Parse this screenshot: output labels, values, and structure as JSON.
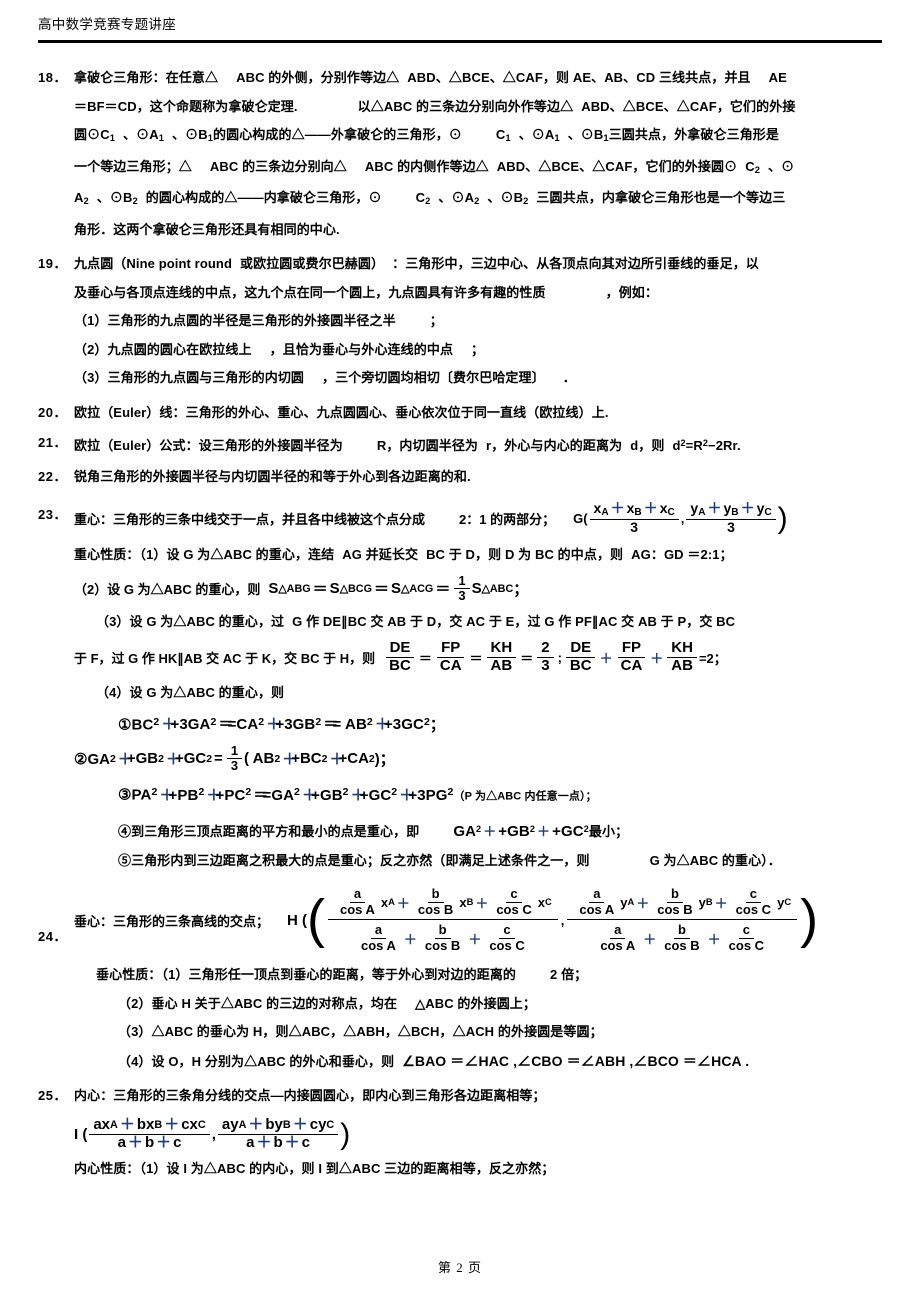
{
  "header": {
    "title": "高中数学竞赛专题讲座"
  },
  "footer": {
    "page_label": "第 2 页"
  },
  "items": {
    "n18": {
      "num": "18．",
      "l1a": "拿破仑三角形：在任意△",
      "l1b": "ABC 的外侧，分别作等边△",
      "l1c": "ABD、△BCE、△CAF，则 AE、AB、CD 三线共点，并且",
      "l1d": "AE",
      "l2a": "＝BF＝CD，这个命题称为拿破仑定理.",
      "l2b": "以△ABC 的三条边分别向外作等边△",
      "l2c": "ABD、△BCE、△CAF，它们的外接",
      "l3a": "圆⊙C",
      "l3a_sub": "1",
      "l3b": "、⊙A",
      "l3b_sub": "1",
      "l3c": "、⊙B",
      "l3c_sub": "1",
      "l3d": "的圆心构成的△——外拿破仑的三角形，⊙",
      "l3e": "C",
      "l3e_sub": "1",
      "l3f": "、⊙A",
      "l3f_sub": "1",
      "l3g": "、⊙B",
      "l3g_sub": "1",
      "l3h": "三圆共点，外拿破仑三角形是",
      "l4a": "一个等边三角形；△",
      "l4b": "ABC 的三条边分别向△",
      "l4c": "ABC 的内侧作等边△",
      "l4d": "ABD、△BCE、△CAF，它们的外接圆⊙",
      "l4e": "C",
      "l4e_sub": "2",
      "l4f": "、⊙",
      "l5a": "A",
      "l5a_sub": "2",
      "l5b": "、⊙B",
      "l5b_sub": "2",
      "l5c": "的圆心构成的△——内拿破仑三角形，⊙",
      "l5d": "C",
      "l5d_sub": "2",
      "l5e": "、⊙A",
      "l5e_sub": "2",
      "l5f": "、⊙B",
      "l5f_sub": "2",
      "l5g": "三圆共点，内拿破仑三角形也是一个等边三",
      "l6": "角形．这两个拿破仑三角形还具有相同的中心."
    },
    "n19": {
      "num": "19．",
      "l1a": "九点圆（",
      "l1b": "Nine point round",
      "l1c": "或欧拉圆或费尔巴赫圆）",
      "l1d": "：三角形中，三边中心、从各顶点向其对边所引垂线的垂足，以",
      "l2a": "及垂心与各顶点连线的中点，这九个点在同一个圆上，九点圆具有许多有趣的性质",
      "l2b": "，例如：",
      "p1a": "（1）三角形的九点圆的半径是三角形的外接圆半径之半",
      "p1b": "；",
      "p2a": "（2）九点圆的圆心在欧拉线上",
      "p2b": "，且恰为垂心与外心连线的中点",
      "p2c": "；",
      "p3a": "（3）三角形的九点圆与三角形的内切圆",
      "p3b": "，三个旁切圆均相切〔费尔巴哈定理〕",
      "p3c": "．"
    },
    "n20": {
      "num": "20．",
      "text": "欧拉（Euler）线：三角形的外心、重心、九点圆圆心、垂心依次位于同一直线（欧拉线）上."
    },
    "n21": {
      "num": "21．",
      "t1": "欧拉（Euler）公式：设三角形的外接圆半径为",
      "t2": "R，内切圆半径为",
      "t3": "r，外心与内心的距离为",
      "t4": "d，则",
      "t5_d": "d",
      "t5_sup": "2",
      "t5_eq": "=R",
      "t5_sup2": "2",
      "t5_rest": "−2Rr."
    },
    "n22": {
      "num": "22．",
      "text": "锐角三角形的外接圆半径与内切圆半径的和等于外心到各边距离的和."
    },
    "n23": {
      "num": "23．",
      "l1a": "重心：三角形的三条中线交于一点，并且各中线被这个点分成",
      "l1b": "2：1 的两部分；",
      "g_label": "G(",
      "g_num1": "x",
      "g_num1_subs": [
        "A",
        "B",
        "C"
      ],
      "g_den": "3",
      "g_num2": "y",
      "g_num2_subs": [
        "A",
        "B",
        "C"
      ],
      "g_close": ")",
      "p1a": "重心性质：（1）设 G 为△ABC 的重心，连结",
      "p1b": "AG 并延长交",
      "p1c": "BC 于 D，则 D 为 BC 的中点，则",
      "p1d": "AG：GD ＝2:1；",
      "p2a": "（2）设 G 为△ABC 的重心，则",
      "p2_S": "S",
      "p2_t1": "△ABG",
      "p2_t2": "△BCG",
      "p2_t3": "△ACG",
      "p2_frac_num": "1",
      "p2_frac_den": "3",
      "p2_t4": "△ABC",
      "p2_end": "；",
      "p3a": "（3）设 G 为△ABC 的重心，过",
      "p3b": "G 作 DE∥BC 交 AB 于 D，交 AC 于 E，过 G 作 PF∥AC 交 AB 于 P，交 BC",
      "p3c": "于 F，过 G 作 HK∥AB 交 AC 于 K，交 BC 于 H，则",
      "f1n1": "DE",
      "f1d1": "BC",
      "f1n2": "FP",
      "f1d2": "CA",
      "f1n3": "KH",
      "f1d3": "AB",
      "f1n4": "2",
      "f1d4": "3",
      "f1end": "=2；",
      "p4a": "（4）设 G 为△ABC 的重心，则",
      "e1": "①BC",
      "e1b": "+3GA",
      "e1c": "=CA",
      "e1d": "+3GB",
      "e1e": "= AB",
      "e1f": "+3GC",
      "e1end": "；",
      "e2a": "②GA",
      "e2b": "+GB",
      "e2c": "+GC",
      "e2eq": "=",
      "e2fn": "1",
      "e2fd": "3",
      "e2p1": "( AB",
      "e2p2": "+BC",
      "e2p3": "+CA",
      "e2p4": ")；",
      "e3a": "③PA",
      "e3b": "+PB",
      "e3c": "+PC",
      "e3d": "=GA",
      "e3e": "+GB",
      "e3f": "+GC",
      "e3g": "+3PG",
      "e3note": "（P 为△ABC 内任意一点）；",
      "e4a": "④到三角形三顶点距离的平方和最小的点是重心，即",
      "e4b": "GA",
      "e4c": "+GB",
      "e4d": "+GC",
      "e4end": "最小；",
      "e5a": "⑤三角形内到三边距离之积最大的点是重心；反之亦然（即满足上述条件之一，则",
      "e5b": "G 为△ABC 的重心）．"
    },
    "n24": {
      "num": "24．",
      "l1": "垂心：三角形的三条高线的交点；",
      "h_label": "H (",
      "h_close": ")",
      "h_a": "a",
      "h_b": "b",
      "h_c": "c",
      "h_cosA": "cos A",
      "h_cosB": "cos B",
      "h_cosC": "cos C",
      "h_xA": "x",
      "h_xB": "x",
      "h_xC": "x",
      "h_yA": "y",
      "h_yB": "y",
      "h_yC": "y",
      "sub_A": "A",
      "sub_B": "B",
      "sub_C": "C",
      "comma": ",",
      "p1a": "垂心性质：（1）三角形任一顶点到垂心的距离，等于外心到对边的距离的",
      "p1b": "2 倍；",
      "p2a": "（2）垂心 H 关于△ABC 的三边的对称点，均在",
      "p2b": "△ABC 的外接圆上；",
      "p3a": "（3）△ABC 的垂心为 H，则△ABC，△ABH，△BCH，△ACH 的外接圆是等圆；",
      "p4a": "（4）设 O，H 分别为△ABC 的外心和垂心，则",
      "p4b": "∠BAO ＝∠HAC ,∠CBO ＝∠ABH ,∠BCO ＝∠HCA ."
    },
    "n25": {
      "num": "25．",
      "l1": "内心：三角形的三条角分线的交点—内接圆圆心，即内心到三角形各边距离相等；",
      "i_label": "I (",
      "i_close": ")",
      "i_num1": [
        "ax",
        "bx",
        "cx"
      ],
      "i_num1_subs": [
        "A",
        "B",
        "C"
      ],
      "i_num2": [
        "ay",
        "by",
        "cy"
      ],
      "i_num2_subs": [
        "A",
        "B",
        "C"
      ],
      "i_den": [
        "a",
        "b",
        "c"
      ],
      "i_comma": ",",
      "p1": "内心性质：（1）设 I 为△ABC 的内心，则 I 到△ABC 三边的距离相等，反之亦然；"
    }
  }
}
